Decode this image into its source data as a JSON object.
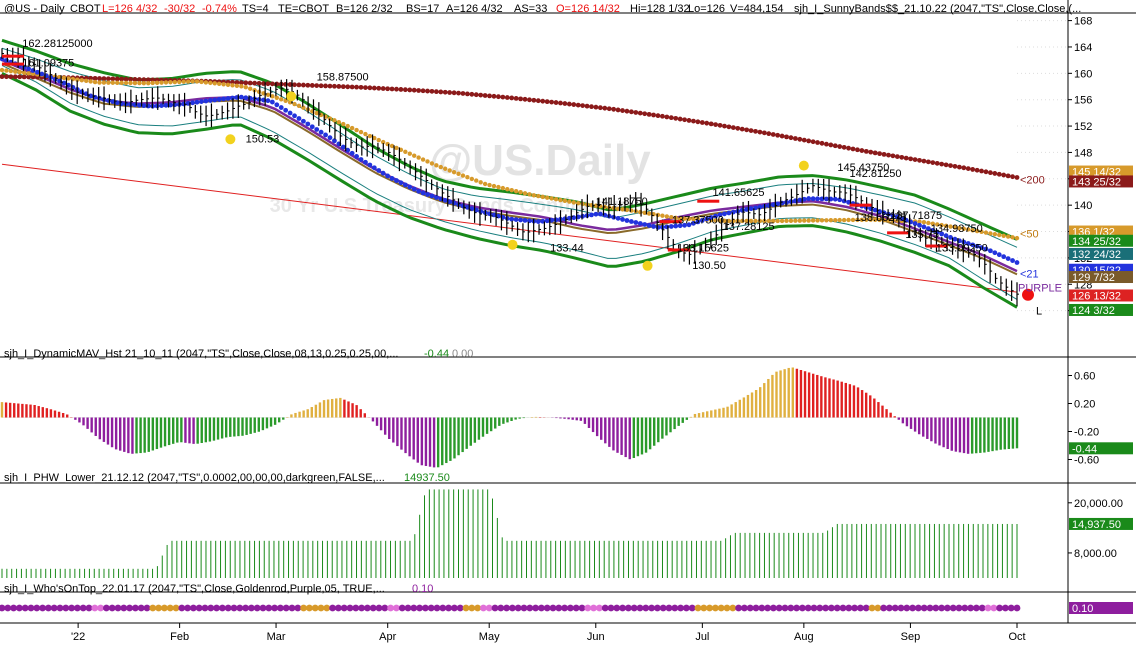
{
  "chart_data": {
    "type": "line",
    "title": "@US.Daily",
    "watermark": {
      "main": "@US.Daily",
      "sub": "30 Yr U.S.Treasury Bonds Continuous"
    },
    "x_axis": {
      "months": [
        {
          "label": "'22"
        },
        {
          "label": "Feb"
        },
        {
          "label": "Mar"
        },
        {
          "label": "Apr"
        },
        {
          "label": "May"
        },
        {
          "label": "Jun"
        },
        {
          "label": "Jul"
        },
        {
          "label": "Aug"
        },
        {
          "label": "Sep"
        },
        {
          "label": "Oct"
        }
      ]
    },
    "panels": [
      {
        "id": "price",
        "header": {
          "symbol": "@US - Daily",
          "exchange": "CBOT",
          "fields": [
            "L=126 4/32",
            "-30/32",
            "-0.74%",
            "TS=4",
            "TE=CBOT",
            "B=126 2/32",
            "BS=17",
            "A=126 4/32",
            "AS=33",
            "O=126 14/32",
            "Hi=128 1/32",
            "Lo=126",
            "V=484,154"
          ],
          "indicator": "sjh_I_SunnyBands$$_21.10.22 (2047,\"TS\",Close,Close,(..."
        },
        "ylim": [
          120,
          169
        ],
        "y_ticks": [
          "168",
          "164",
          "160",
          "156",
          "152",
          "148",
          "144",
          "140",
          "136",
          "132",
          "128",
          "124"
        ],
        "price_path": [
          163,
          162.6,
          162.2,
          161.5,
          160.5,
          159.5,
          158.4,
          157.3,
          156.8,
          156.5,
          156.2,
          155.8,
          155.5,
          155.9,
          156.1,
          156.3,
          156.0,
          155.4,
          155.2,
          154.0,
          153.5,
          153.8,
          154.3,
          155.0,
          155.5,
          156.6,
          157.0,
          157.8,
          157.5,
          156.5,
          155.0,
          153.7,
          152.0,
          150.5,
          149.5,
          148.8,
          149.0,
          148.5,
          147.8,
          146.7,
          145.5,
          144.2,
          143.0,
          141.8,
          140.8,
          139.7,
          138.9,
          138.5,
          138.3,
          137.5,
          136.6,
          135.8,
          136.2,
          136.5,
          137.1,
          137.8,
          138.8,
          139.8,
          140.0,
          139.6,
          139.8,
          140.2,
          140.5,
          139.2,
          137.2,
          135.0,
          133.0,
          132.5,
          133.2,
          134.5,
          136.0,
          137.5,
          139.0,
          138.8,
          138.5,
          139.5,
          140.5,
          141.2,
          142.0,
          143.0,
          142.5,
          142.0,
          142.0,
          141.4,
          140.5,
          139.5,
          138.8,
          138.3,
          137.5,
          136.2,
          135.0,
          134.8,
          134.2,
          133.6,
          133.0,
          132.4,
          130.8,
          128.7,
          127.5,
          126.5
        ],
        "series": [
          {
            "name": "200",
            "color": "#8b1a1a",
            "label_color": "#8b1a1a",
            "values": [
              159.5,
              159.4,
              159.2,
              159.0,
              158.8,
              158.5,
              158.2,
              157.9,
              157.5,
              157.0,
              156.3,
              155.5,
              154.6,
              153.5,
              152.3,
              151.0,
              149.6,
              148.2,
              146.9,
              145.6,
              144.2
            ]
          },
          {
            "name": "50",
            "color": "#d79a2b",
            "label_color": "#c07b10",
            "values": [
              160.5,
              159.6,
              158.6,
              158.5,
              158.8,
              158.0,
              155.5,
              152.5,
              149.2,
              146.0,
              143.2,
              141.5,
              140.2,
              139.2,
              138.0,
              137.6,
              137.6,
              137.7,
              137.8,
              137.5,
              136.3,
              135.0
            ]
          },
          {
            "name": "21",
            "color": "#2233dd",
            "label_color": "#2233dd",
            "values": [
              162.2,
              160.5,
              158.7,
              156.5,
              155.4,
              155.0,
              155.3,
              155.9,
              156.4,
              155.8,
              153.0,
              150.2,
              147.0,
              144.2,
              142.0,
              140.5,
              139.1,
              137.9,
              137.5,
              138.0,
              138.7,
              137.6,
              136.6,
              137.0,
              138.5,
              139.4,
              140.2,
              141.0,
              140.9,
              139.6,
              138.2,
              136.5,
              134.7,
              133.3,
              131.3
            ]
          },
          {
            "name": "PURPLE",
            "color": "#7a2a9e",
            "label_color": "#7a2a9e",
            "values": [
              162.0,
              159.8,
              157.6,
              155.9,
              155.4,
              155.6,
              156.2,
              156.4,
              154.8,
              151.8,
              148.6,
              145.5,
              143.0,
              141.0,
              139.7,
              138.9,
              138.2,
              137.0,
              136.2,
              137.0,
              138.2,
              139.2,
              139.8,
              140.4,
              140.6,
              139.7,
              138.3,
              136.4,
              134.4,
              132.4,
              130.0
            ]
          },
          {
            "name": "upper_band",
            "color": "#1a8a1a",
            "label_color": "#1a8a1a",
            "values": [
              165.0,
              163.4,
              161.5,
              160.1,
              159.0,
              159.2,
              160.0,
              160.3,
              158.5,
              155.5,
              152.2,
              148.8,
              146.0,
              143.7,
              142.6,
              142.0,
              141.3,
              140.5,
              139.2,
              140.2,
              141.4,
              142.6,
              143.4,
              144.3,
              144.5,
              143.8,
              142.7,
              141.5,
              139.4,
              137.1,
              134.8
            ]
          },
          {
            "name": "lower_band",
            "color": "#1a8a1a",
            "label_color": "#1a8a1a",
            "values": [
              160.0,
              157.5,
              154.3,
              152.3,
              151.0,
              150.8,
              151.5,
              152.3,
              150.0,
              147.0,
              143.8,
              140.7,
              138.2,
              136.4,
              135.0,
              133.9,
              133.1,
              131.9,
              130.6,
              131.5,
              133.0,
              134.8,
              135.8,
              136.8,
              136.9,
              135.9,
              134.5,
              132.8,
              130.8,
              127.5,
              124.5
            ]
          }
        ],
        "trendline": {
          "from": 146.2,
          "to": 126.8
        },
        "annotations": [
          "162.28125000",
          "161.09375",
          "158.87500",
          "150.53",
          "141.18750",
          "133.44",
          "141.65625",
          "137.37500",
          "137.28125",
          "133.15625",
          "130.50",
          "145.43750",
          "142.81250",
          "137.71875",
          "138.56275",
          "135.75",
          "134.93750",
          "133.09250"
        ],
        "right_labels": [
          {
            "text": "145 14/32",
            "bg": "#d79a2b",
            "fg": "#ffffff"
          },
          {
            "text": "143 25/32",
            "bg": "#8b1a1a",
            "fg": "#ffffff"
          },
          {
            "text": "136 1/32",
            "bg": "#d79a2b",
            "fg": "#ffffff"
          },
          {
            "text": "134 25/32",
            "bg": "#1a8a1a",
            "fg": "#ffffff"
          },
          {
            "text": "132 24/32",
            "bg": "#1a6f78",
            "fg": "#ffffff"
          },
          {
            "text": "130 15/32",
            "bg": "#2233dd",
            "fg": "#ffffff"
          },
          {
            "text": "129 7/32",
            "bg": "#7a5a2a",
            "fg": "#ffffff"
          },
          {
            "text": "126 13/32",
            "bg": "#dd2222",
            "fg": "#ffffff"
          },
          {
            "text": "124 3/32",
            "bg": "#1a8a1a",
            "fg": "#ffffff"
          }
        ],
        "line_end_labels": [
          "200",
          "50",
          "21",
          "PURPLE",
          "L"
        ]
      },
      {
        "id": "dynamic_mav",
        "header": "sjh_I_DynamicMAV_Hst 21_10_11 (2047,\"TS\",Close,Close,08,13,0.25,0.25,00,...",
        "header_values": [
          "-0.44",
          "0.00"
        ],
        "ylim": [
          -0.75,
          0.85
        ],
        "y_ticks": [
          "0.60",
          "0.20",
          "-0.20",
          "-0.60"
        ],
        "last_value_label": "-0.44",
        "histogram": [
          0.22,
          0.2,
          0.18,
          0.12,
          0.05,
          -0.1,
          -0.3,
          -0.45,
          -0.52,
          -0.5,
          -0.42,
          -0.35,
          -0.38,
          -0.34,
          -0.28,
          -0.26,
          -0.2,
          -0.1,
          0.05,
          0.12,
          0.25,
          0.28,
          0.18,
          -0.05,
          -0.3,
          -0.5,
          -0.68,
          -0.72,
          -0.6,
          -0.42,
          -0.25,
          -0.1,
          -0.02,
          0.01,
          0.0,
          -0.02,
          -0.05,
          -0.28,
          -0.48,
          -0.6,
          -0.5,
          -0.3,
          -0.12,
          0.05,
          0.1,
          0.15,
          0.28,
          0.42,
          0.65,
          0.72,
          0.65,
          0.58,
          0.52,
          0.45,
          0.3,
          0.1,
          -0.1,
          -0.25,
          -0.38,
          -0.48,
          -0.52,
          -0.5,
          -0.46,
          -0.44
        ]
      },
      {
        "id": "phw_lower",
        "header": "sjh_I_PHW_Lower_21.12.12 (2047,\"TS\",0.0002,00,00,00,darkgreen,FALSE,...",
        "header_values": [
          "14937.50"
        ],
        "ylim": [
          2000,
          24500
        ],
        "y_ticks": [
          "20,000.00",
          "8,000.00"
        ],
        "last_value_label": "14,937.50",
        "values": [
          4200,
          4200,
          4200,
          4200,
          4200,
          4200,
          4200,
          4200,
          4200,
          4200,
          4200,
          4200,
          4200,
          10900,
          10900,
          10900,
          10900,
          10900,
          10900,
          10900,
          10900,
          10900,
          10900,
          10900,
          10900,
          10900,
          10900,
          10900,
          10900,
          10900,
          10900,
          10900,
          10900,
          23200,
          23200,
          23200,
          23200,
          23200,
          23200,
          10900,
          10900,
          10900,
          10900,
          10900,
          10900,
          10900,
          10900,
          10900,
          10900,
          10900,
          10900,
          10900,
          10900,
          10900,
          10900,
          10900,
          10900,
          12800,
          12800,
          12800,
          12800,
          12800,
          12800,
          12800,
          12800,
          14937.5,
          14937.5,
          14937.5,
          14937.5,
          14937.5,
          14937.5,
          14937.5,
          14937.5,
          14937.5,
          14937.5,
          14937.5,
          14937.5,
          14937.5,
          14937.5,
          14937.5
        ]
      },
      {
        "id": "whos_on_top",
        "header": "sjh_I_Who'sOnTop_22.01.17 (2047,\"TS\",Close,Goldenrod,Purple,05, TRUE,...",
        "header_values": [
          "0.10"
        ],
        "last_value_label": "0.10",
        "sequence": "PPPPPPPPPPPPPPPPMMPPPPPPPPGGGGGPPPPPPPPPPPPPPPPPPPPPGGGGGPPPPPPPPPPMMPPPPPPPPPPPGGGMMPPPPPPPPPPPPPPPPMMMPPPPPPPPPPPPPPPPGGGGGGGPPPPPPPPPPPPPPPPPPPPPPPGGPPPPPPPPPPPPPPPPPPMMPPPP",
        "colors": {
          "P": "#8e1e9e",
          "G": "#d89a2a",
          "M": "#e070d8"
        }
      }
    ]
  }
}
